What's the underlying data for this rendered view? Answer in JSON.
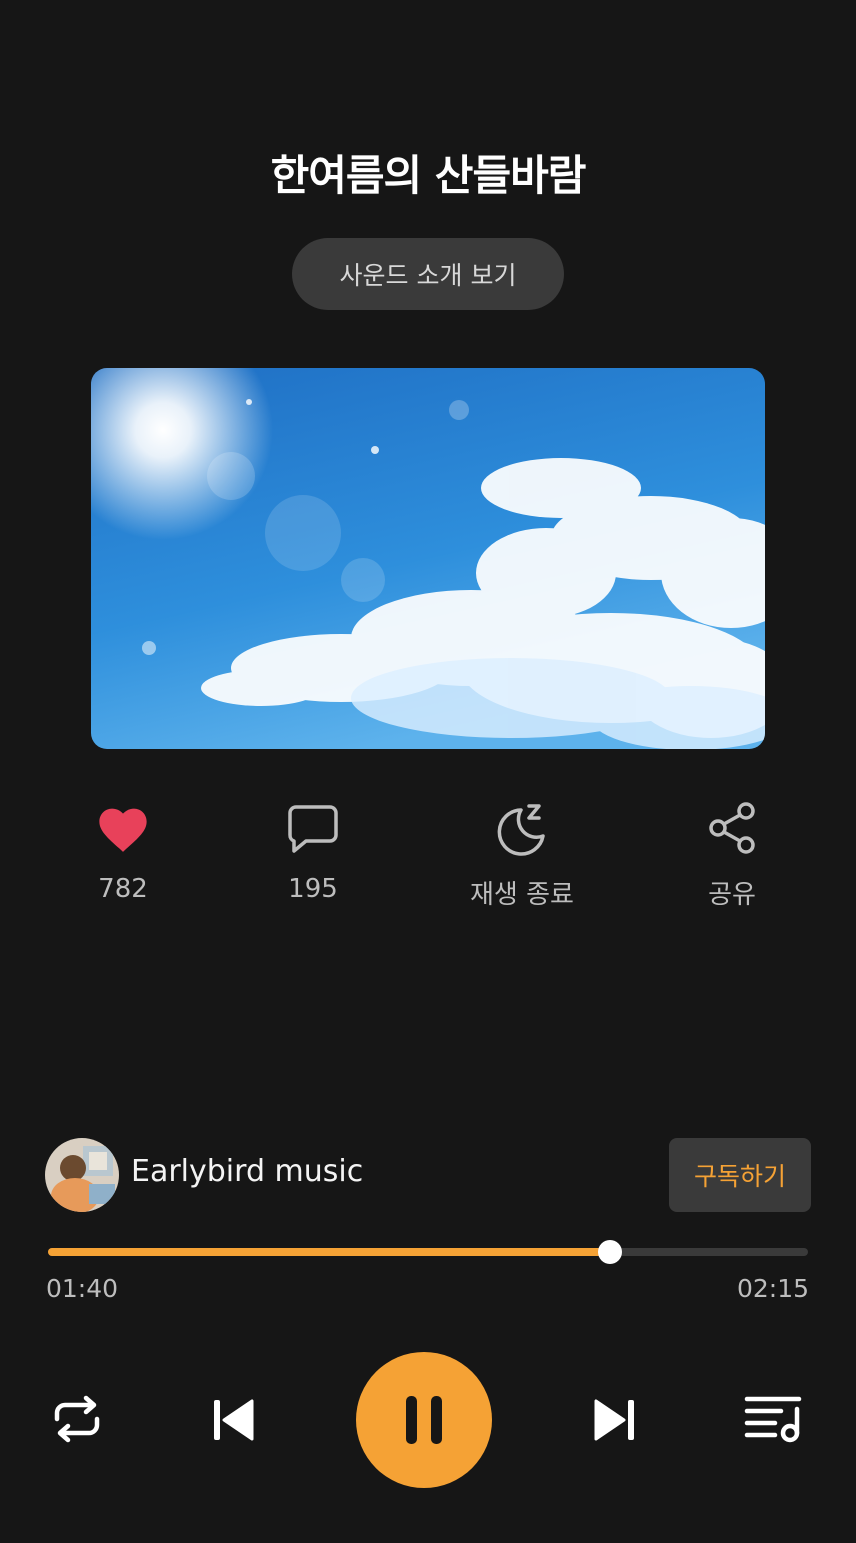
{
  "track": {
    "title": "한여름의 산들바람",
    "intro_button": "사운드 소개 보기"
  },
  "actions": {
    "likes": "782",
    "comments": "195",
    "sleep_timer": "재생 종료",
    "share": "공유"
  },
  "channel": {
    "name": "Earlybird music",
    "subscribe_label": "구독하기"
  },
  "player": {
    "current_time": "01:40",
    "total_time": "02:15",
    "progress": 0.74,
    "state": "playing"
  },
  "colors": {
    "accent": "#f5a235",
    "heart": "#e8415a",
    "background": "#161616"
  },
  "icons": [
    "heart-icon",
    "comment-icon",
    "moon-sleep-icon",
    "share-icon",
    "repeat-icon",
    "previous-icon",
    "pause-icon",
    "next-icon",
    "playlist-icon"
  ]
}
